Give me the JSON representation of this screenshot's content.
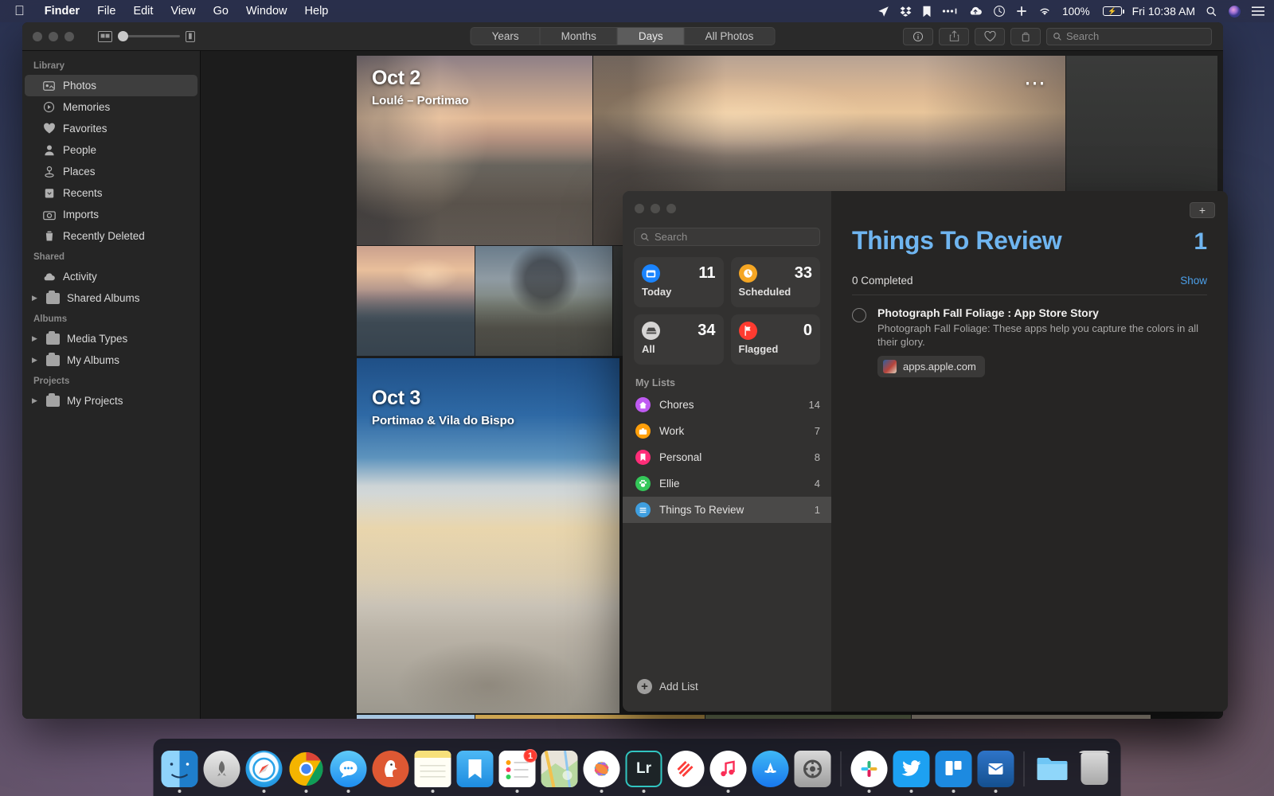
{
  "menubar": {
    "apple_icon": "apple-logo",
    "items": [
      {
        "label": "Finder",
        "bold": true
      },
      {
        "label": "File",
        "bold": false
      },
      {
        "label": "Edit",
        "bold": false
      },
      {
        "label": "View",
        "bold": false
      },
      {
        "label": "Go",
        "bold": false
      },
      {
        "label": "Window",
        "bold": false
      },
      {
        "label": "Help",
        "bold": false
      }
    ],
    "status_icons": [
      "location-arrow-icon",
      "dropbox-icon",
      "bookmark-icon",
      "dots-icon",
      "cloud-upload-icon",
      "time-machine-icon",
      "vpn-icon",
      "wifi-icon"
    ],
    "battery_percent": "100%",
    "clock": "Fri 10:38 AM",
    "right_icons": [
      "search-icon",
      "siri-icon",
      "control-center-icon"
    ]
  },
  "photos": {
    "zoom_slider_value": 8,
    "view_modes": [
      {
        "label": "Years",
        "active": false
      },
      {
        "label": "Months",
        "active": false
      },
      {
        "label": "Days",
        "active": true
      },
      {
        "label": "All Photos",
        "active": false
      }
    ],
    "toolbar_buttons": [
      "info-icon",
      "share-icon",
      "favorite-icon",
      "rotate-icon"
    ],
    "search_placeholder": "Search",
    "sidebar": {
      "sections": [
        {
          "header": "Library",
          "items": [
            {
              "label": "Photos",
              "icon": "photos-icon",
              "selected": true,
              "expandable": false
            },
            {
              "label": "Memories",
              "icon": "memories-icon",
              "selected": false,
              "expandable": false
            },
            {
              "label": "Favorites",
              "icon": "heart-icon",
              "selected": false,
              "expandable": false
            },
            {
              "label": "People",
              "icon": "person-icon",
              "selected": false,
              "expandable": false
            },
            {
              "label": "Places",
              "icon": "pin-icon",
              "selected": false,
              "expandable": false
            },
            {
              "label": "Recents",
              "icon": "recents-icon",
              "selected": false,
              "expandable": false
            },
            {
              "label": "Imports",
              "icon": "camera-icon",
              "selected": false,
              "expandable": false
            },
            {
              "label": "Recently Deleted",
              "icon": "trash-icon",
              "selected": false,
              "expandable": false
            }
          ]
        },
        {
          "header": "Shared",
          "items": [
            {
              "label": "Activity",
              "icon": "cloud-icon",
              "selected": false,
              "expandable": false
            },
            {
              "label": "Shared Albums",
              "icon": "folder-icon",
              "selected": false,
              "expandable": true
            }
          ]
        },
        {
          "header": "Albums",
          "items": [
            {
              "label": "Media Types",
              "icon": "folder-icon",
              "selected": false,
              "expandable": true
            },
            {
              "label": "My Albums",
              "icon": "folder-icon",
              "selected": false,
              "expandable": true
            }
          ]
        },
        {
          "header": "Projects",
          "items": [
            {
              "label": "My Projects",
              "icon": "folder-icon",
              "selected": false,
              "expandable": true
            }
          ]
        }
      ]
    },
    "days": [
      {
        "date": "Oct 2",
        "place": "Loulé – Portimao"
      },
      {
        "date": "Oct 3",
        "place": "Portimao & Vila do Bispo"
      }
    ]
  },
  "reminders": {
    "search_placeholder": "Search",
    "add_button_icon": "plus-icon",
    "smart_lists": [
      {
        "label": "Today",
        "count": "11",
        "icon": "calendar-day-icon",
        "color": "#1a84ff"
      },
      {
        "label": "Scheduled",
        "count": "33",
        "icon": "clock-icon",
        "color": "#f5a623"
      },
      {
        "label": "All",
        "count": "34",
        "icon": "tray-icon",
        "color": "#8e8e93"
      },
      {
        "label": "Flagged",
        "count": "0",
        "icon": "flag-icon",
        "color": "#ff3b30"
      }
    ],
    "my_lists_header": "My Lists",
    "lists": [
      {
        "label": "Chores",
        "count": "14",
        "icon": "house-icon",
        "color": "#bf5af2",
        "selected": false
      },
      {
        "label": "Work",
        "count": "7",
        "icon": "briefcase-icon",
        "color": "#ff9f0a",
        "selected": false
      },
      {
        "label": "Personal",
        "count": "8",
        "icon": "bookmark-icon",
        "color": "#ff2d78",
        "selected": false
      },
      {
        "label": "Ellie",
        "count": "4",
        "icon": "paw-icon",
        "color": "#34c759",
        "selected": false
      },
      {
        "label": "Things To Review",
        "count": "1",
        "icon": "list-icon",
        "color": "#3f9fe0",
        "selected": true
      }
    ],
    "add_list_label": "Add List",
    "detail": {
      "title": "Things To Review",
      "count": "1",
      "completed_label": "0 Completed",
      "show_label": "Show",
      "items": [
        {
          "title": "Photograph Fall Foliage : App Store Story",
          "notes": "Photograph Fall Foliage: These apps help you capture the colors in all their glory.",
          "link": "apps.apple.com",
          "completed": false
        }
      ]
    }
  },
  "dock": {
    "items": [
      {
        "name": "finder",
        "label": "Finder",
        "running": true,
        "badge": null
      },
      {
        "name": "launchpad",
        "label": "Launchpad",
        "running": false,
        "badge": null
      },
      {
        "name": "safari",
        "label": "Safari",
        "running": true,
        "badge": null
      },
      {
        "name": "chrome",
        "label": "Google Chrome",
        "running": true,
        "badge": null
      },
      {
        "name": "messages",
        "label": "Messages",
        "running": true,
        "badge": null
      },
      {
        "name": "duckduckgo",
        "label": "DuckDuckGo",
        "running": false,
        "badge": null
      },
      {
        "name": "notes",
        "label": "Notes",
        "running": true,
        "badge": null
      },
      {
        "name": "books",
        "label": "Books",
        "running": false,
        "badge": null
      },
      {
        "name": "reminders",
        "label": "Reminders",
        "running": true,
        "badge": "1"
      },
      {
        "name": "maps",
        "label": "Maps",
        "running": false,
        "badge": null
      },
      {
        "name": "photos",
        "label": "Photos",
        "running": true,
        "badge": null
      },
      {
        "name": "lightroom",
        "label": "Lr",
        "running": true,
        "badge": null
      },
      {
        "name": "news",
        "label": "News",
        "running": false,
        "badge": null
      },
      {
        "name": "music",
        "label": "Music",
        "running": true,
        "badge": null
      },
      {
        "name": "app-store",
        "label": "App Store",
        "running": false,
        "badge": null
      },
      {
        "name": "system-preferences",
        "label": "System Preferences",
        "running": false,
        "badge": null
      },
      {
        "name": "slack",
        "label": "Slack",
        "running": true,
        "badge": null
      },
      {
        "name": "twitter",
        "label": "Twitter",
        "running": true,
        "badge": null
      },
      {
        "name": "trello",
        "label": "Trello",
        "running": true,
        "badge": null
      },
      {
        "name": "airmail",
        "label": "Mail",
        "running": true,
        "badge": null
      }
    ],
    "downloads_label": "Downloads",
    "trash_label": "Trash"
  }
}
